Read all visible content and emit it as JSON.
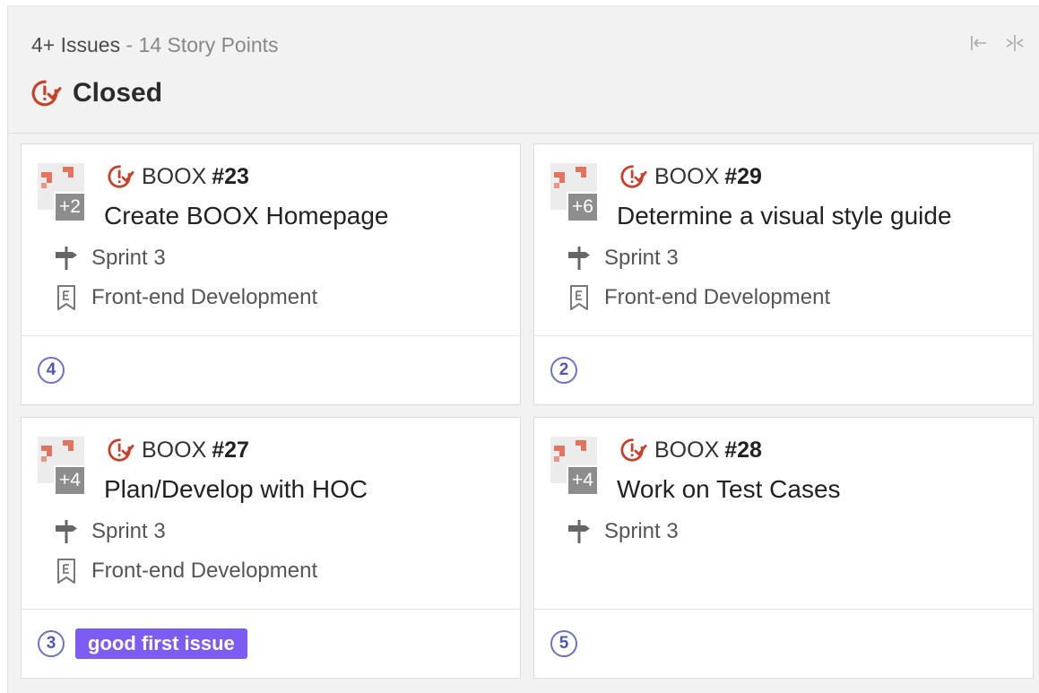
{
  "column": {
    "summary_issues": "4+ Issues",
    "summary_sep": " - ",
    "summary_points": "14 Story Points",
    "state_title": "Closed",
    "state_icon": "closed-issue-icon",
    "actions": [
      "collapse-icon",
      "expand-icon"
    ]
  },
  "colors": {
    "closed_red": "#c8412b",
    "estimate_blue": "#6b72c9",
    "label_purple": "#7d5cf4"
  },
  "cards": [
    {
      "repo": "BOOX",
      "number": "#23",
      "title": "Create BOOX Homepage",
      "more_assignees": "+2",
      "milestone": "Sprint 3",
      "epic": "Front-end Development",
      "estimate": "4",
      "label": ""
    },
    {
      "repo": "BOOX",
      "number": "#29",
      "title": "Determine a visual style guide",
      "more_assignees": "+6",
      "milestone": "Sprint 3",
      "epic": "Front-end Development",
      "estimate": "2",
      "label": ""
    },
    {
      "repo": "BOOX",
      "number": "#27",
      "title": "Plan/Develop with HOC",
      "more_assignees": "+4",
      "milestone": "Sprint 3",
      "epic": "Front-end Development",
      "estimate": "3",
      "label": "good first issue"
    },
    {
      "repo": "BOOX",
      "number": "#28",
      "title": "Work on Test Cases",
      "more_assignees": "+4",
      "milestone": "Sprint 3",
      "epic": "",
      "estimate": "5",
      "label": ""
    }
  ]
}
